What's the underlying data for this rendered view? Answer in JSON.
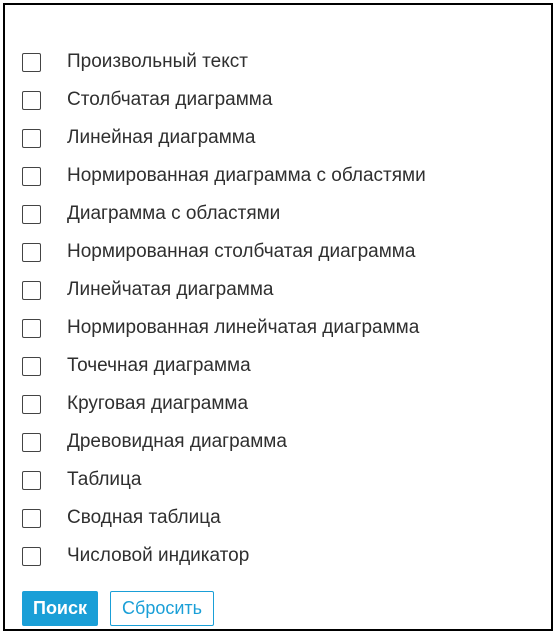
{
  "filter": {
    "options": [
      {
        "label": "Произвольный текст",
        "checked": false
      },
      {
        "label": "Столбчатая диаграмма",
        "checked": false
      },
      {
        "label": "Линейная диаграмма",
        "checked": false
      },
      {
        "label": "Нормированная диаграмма с областями",
        "checked": false
      },
      {
        "label": "Диаграмма с областями",
        "checked": false
      },
      {
        "label": "Нормированная столбчатая диаграмма",
        "checked": false
      },
      {
        "label": "Линейчатая диаграмма",
        "checked": false
      },
      {
        "label": "Нормированная линейчатая диаграмма",
        "checked": false
      },
      {
        "label": "Точечная диаграмма",
        "checked": false
      },
      {
        "label": "Круговая диаграмма",
        "checked": false
      },
      {
        "label": "Древовидная диаграмма",
        "checked": false
      },
      {
        "label": "Таблица",
        "checked": false
      },
      {
        "label": "Сводная таблица",
        "checked": false
      },
      {
        "label": "Числовой индикатор",
        "checked": false
      }
    ]
  },
  "actions": {
    "search_label": "Поиск",
    "reset_label": "Сбросить"
  },
  "colors": {
    "accent": "#1a9fd7",
    "text": "#2f2f2f",
    "border": "#000000"
  }
}
